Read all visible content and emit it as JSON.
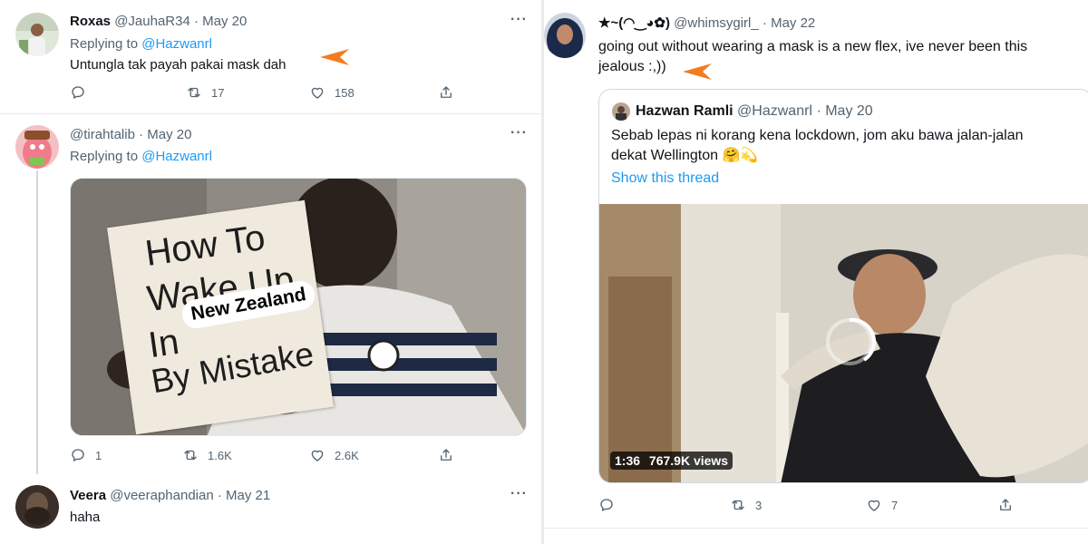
{
  "left": {
    "tweet1": {
      "name": "Roxas",
      "handle": "@JauhaR34",
      "sep": "·",
      "date": "May 20",
      "replying_label": "Replying to",
      "replying_handle": "@Hazwanrl",
      "text": "Untungla tak payah pakai mask dah",
      "replies": "",
      "retweets": "17",
      "likes": "158"
    },
    "tweet2": {
      "name": "",
      "handle": "@tirahtalib",
      "sep": "·",
      "date": "May 20",
      "replying_label": "Replying to",
      "replying_handle": "@Hazwanrl",
      "meme": {
        "line1": "How To",
        "line2": "Wake Up",
        "line3": "In",
        "line4": "By Mistake",
        "pill": "New Zealand"
      },
      "replies": "1",
      "retweets": "1.6K",
      "likes": "2.6K"
    },
    "tweet3": {
      "name": "Veera",
      "handle": "@veeraphandian",
      "sep": "·",
      "date": "May 21",
      "text": "haha"
    }
  },
  "right": {
    "tweet": {
      "name": "★~(◠‿◕✿)",
      "handle": "@whimsygirl_",
      "sep": "·",
      "date": "May 22",
      "text_line1": "going out without wearing a mask is a new flex, ive never been this",
      "text_line2": "jealous :,))",
      "replies": "",
      "retweets": "3",
      "likes": "7"
    },
    "quote": {
      "name": "Hazwan Ramli",
      "handle": "@Hazwanrl",
      "sep": "·",
      "date": "May 20",
      "text_line1": "Sebab lepas ni korang kena lockdown, jom aku bawa jalan-jalan",
      "text_line2": "dekat Wellington 🤗💫",
      "show_thread": "Show this thread",
      "video_duration": "1:36",
      "video_views": "767.9K views"
    }
  },
  "colors": {
    "accent": "#1d9bf0",
    "secondary_text": "#536471",
    "arrow": "#f47b20"
  },
  "icons": [
    "reply-icon",
    "retweet-icon",
    "like-icon",
    "share-icon",
    "more-icon",
    "arrow-annotation-icon",
    "video-loading-icon"
  ]
}
